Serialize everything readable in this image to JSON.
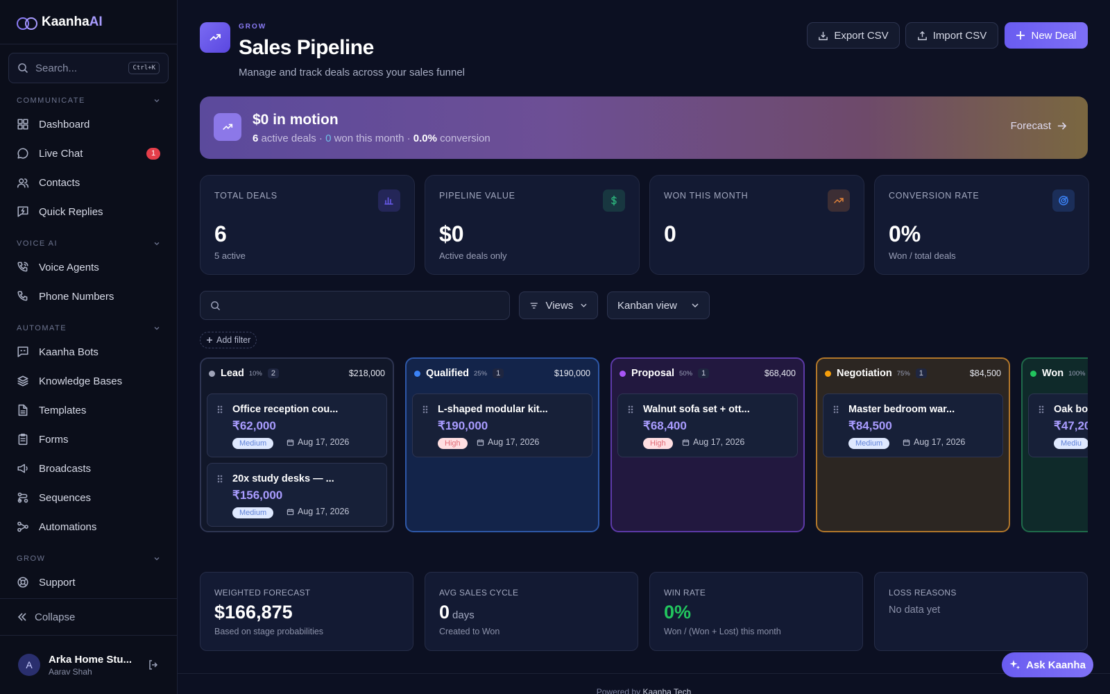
{
  "app": {
    "logo_main": "Kaanha",
    "logo_accent": "AI"
  },
  "sidebar": {
    "search_placeholder": "Search...",
    "shortcut": "Ctrl+K",
    "sections": [
      {
        "title": "COMMUNICATE",
        "items": [
          {
            "label": "Dashboard",
            "icon": "grid-icon"
          },
          {
            "label": "Live Chat",
            "icon": "chat-icon",
            "badge": "1"
          },
          {
            "label": "Contacts",
            "icon": "users-icon"
          },
          {
            "label": "Quick Replies",
            "icon": "bolt-message-icon"
          }
        ]
      },
      {
        "title": "VOICE AI",
        "items": [
          {
            "label": "Voice Agents",
            "icon": "phone-wave-icon"
          },
          {
            "label": "Phone Numbers",
            "icon": "phone-icon"
          }
        ]
      },
      {
        "title": "AUTOMATE",
        "items": [
          {
            "label": "Kaanha Bots",
            "icon": "bot-icon"
          },
          {
            "label": "Knowledge Bases",
            "icon": "layers-icon"
          },
          {
            "label": "Templates",
            "icon": "file-icon"
          },
          {
            "label": "Forms",
            "icon": "clipboard-icon"
          },
          {
            "label": "Broadcasts",
            "icon": "megaphone-icon"
          },
          {
            "label": "Sequences",
            "icon": "route-icon"
          },
          {
            "label": "Automations",
            "icon": "workflow-icon"
          }
        ]
      },
      {
        "title": "GROW",
        "items": [
          {
            "label": "Support",
            "icon": "lifebuoy-icon"
          }
        ]
      }
    ],
    "collapse_label": "Collapse",
    "user": {
      "initial": "A",
      "name": "Arka Home Stu...",
      "sub": "Aarav Shah"
    }
  },
  "header": {
    "kicker": "GROW",
    "title": "Sales Pipeline",
    "subtitle": "Manage and track deals across your sales funnel",
    "export_label": "Export CSV",
    "import_label": "Import CSV",
    "new_label": "New Deal"
  },
  "banner": {
    "title": "$0 in motion",
    "active_count": "6",
    "active_text": "active deals ·",
    "won_count": "0",
    "won_text": "won this month ·",
    "conversion": "0.0%",
    "conversion_text": "conversion",
    "forecast_label": "Forecast"
  },
  "stats": [
    {
      "label": "TOTAL DEALS",
      "value": "6",
      "sub": "5 active",
      "icon": "bar-chart-icon",
      "color": "#6a5cf0"
    },
    {
      "label": "PIPELINE VALUE",
      "value": "$0",
      "sub": "Active deals only",
      "icon": "dollar-icon",
      "color": "#2bb07a"
    },
    {
      "label": "WON THIS MONTH",
      "value": "0",
      "sub": "",
      "icon": "trend-up-icon",
      "color": "#e3843a"
    },
    {
      "label": "CONVERSION RATE",
      "value": "0%",
      "sub": "Won / total deals",
      "icon": "target-icon",
      "color": "#3b82f6"
    }
  ],
  "filters": {
    "search_placeholder": "",
    "views_label": "Views",
    "view_mode": "Kanban view",
    "add_filter": "Add filter"
  },
  "kanban": {
    "columns": [
      {
        "name": "Lead",
        "pct": "10%",
        "count": "2",
        "value": "$218,000",
        "color": "#a0a4b8",
        "border": "#2e3552",
        "bg": "#111729",
        "cards": [
          {
            "title": "Office reception cou...",
            "amount": "₹62,000",
            "priority": "Medium",
            "date": "Aug 17, 2026"
          },
          {
            "title": "20x study desks — ...",
            "amount": "₹156,000",
            "priority": "Medium",
            "date": "Aug 17, 2026"
          }
        ]
      },
      {
        "name": "Qualified",
        "pct": "25%",
        "count": "1",
        "value": "$190,000",
        "color": "#3b82f6",
        "border": "#2e58a8",
        "bg": "#13244a",
        "cards": [
          {
            "title": "L-shaped modular kit...",
            "amount": "₹190,000",
            "priority": "High",
            "date": "Aug 17, 2026"
          }
        ]
      },
      {
        "name": "Proposal",
        "pct": "50%",
        "count": "1",
        "value": "$68,400",
        "color": "#a855f7",
        "border": "#5d3aa8",
        "bg": "#22183f",
        "cards": [
          {
            "title": "Walnut sofa set + ott...",
            "amount": "₹68,400",
            "priority": "High",
            "date": "Aug 17, 2026"
          }
        ]
      },
      {
        "name": "Negotiation",
        "pct": "75%",
        "count": "1",
        "value": "$84,500",
        "color": "#f59e0b",
        "border": "#b2772a",
        "bg": "#2c2622",
        "cards": [
          {
            "title": "Master bedroom war...",
            "amount": "₹84,500",
            "priority": "Medium",
            "date": "Aug 17, 2026"
          }
        ]
      },
      {
        "name": "Won",
        "pct": "100%",
        "count": "",
        "value": "",
        "color": "#22c55e",
        "border": "#1f6b4a",
        "bg": "#0f2a2a",
        "cards": [
          {
            "title": "Oak bo",
            "amount": "₹47,20",
            "priority": "Mediu",
            "date": ""
          }
        ]
      }
    ]
  },
  "metrics": [
    {
      "label": "WEIGHTED FORECAST",
      "value": "$166,875",
      "unit": "",
      "sub": "Based on stage probabilities",
      "color": "#ffffff"
    },
    {
      "label": "AVG SALES CYCLE",
      "value": "0",
      "unit": "days",
      "sub": "Created to Won",
      "color": "#ffffff"
    },
    {
      "label": "WIN RATE",
      "value": "0%",
      "unit": "",
      "sub": "Won / (Won + Lost) this month",
      "color": "#22c55e"
    },
    {
      "label": "LOSS REASONS",
      "value": "",
      "unit": "",
      "sub": "No data yet",
      "color": "#ffffff"
    }
  ],
  "ask_label": "Ask Kaanha",
  "footer": {
    "prefix": "Powered by",
    "brand": "Kaanha Tech"
  }
}
